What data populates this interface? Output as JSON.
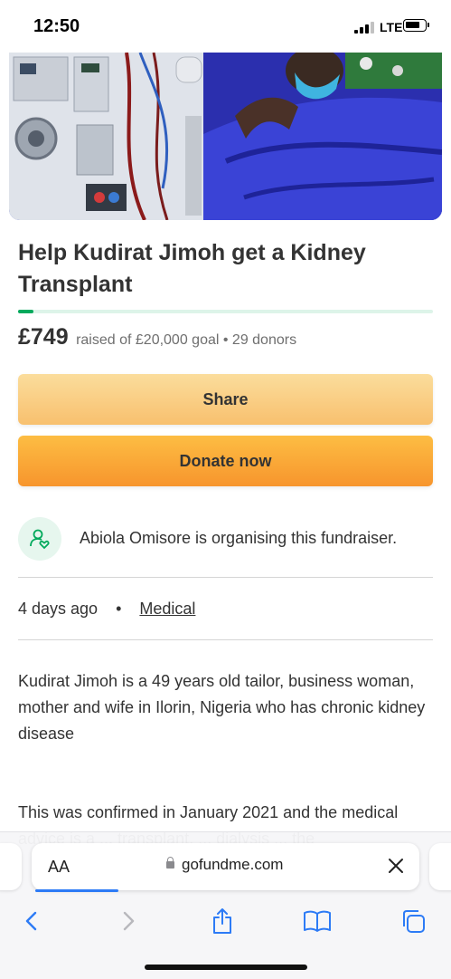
{
  "status_bar": {
    "time": "12:50",
    "network": "LTE"
  },
  "campaign": {
    "title": "Help Kudirat Jimoh get a Kidney Transplant",
    "amount_raised": "£749",
    "raised_meta": "raised of £20,000 goal • 29 donors",
    "progress_fraction": 0.037,
    "accent_color": "#02a95c"
  },
  "actions": {
    "share_label": "Share",
    "donate_label": "Donate now"
  },
  "organiser": {
    "text": "Abiola Omisore is organising this fundraiser.",
    "icon": "person-heart-icon"
  },
  "meta": {
    "posted": "4 days ago",
    "separator": "•",
    "category": "Medical"
  },
  "story": {
    "paragraph_1": "Kudirat Jimoh is a 49 years old tailor, business woman, mother and wife in Ilorin, Nigeria who has chronic kidney disease",
    "paragraph_2": "This was confirmed in January 2021 and the medical",
    "paragraph_3": "advice is a ... transplant, ... dialysis ... the"
  },
  "browser": {
    "text_size_label": "AA",
    "domain": "gofundme.com",
    "toolbar": [
      "back-icon",
      "forward-icon",
      "share-icon",
      "bookmarks-icon",
      "tabs-icon"
    ]
  }
}
